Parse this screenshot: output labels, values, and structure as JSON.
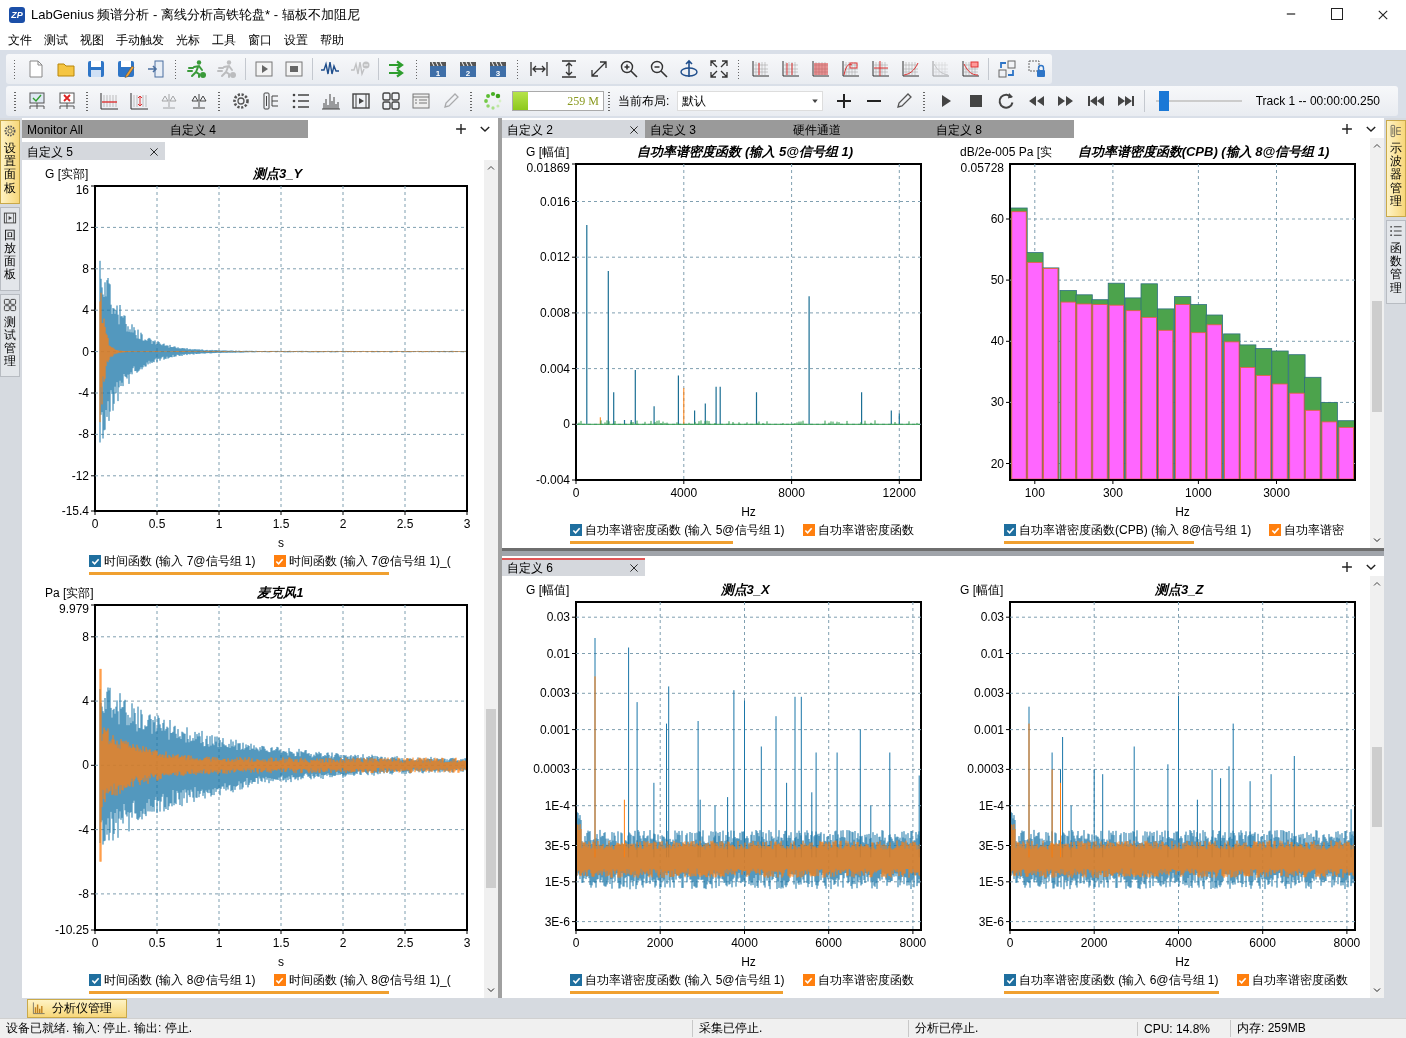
{
  "window": {
    "logo": "ZP",
    "title": "LabGenius 频谱分析 - 离线分析高铁轮盘* - 辐板不加阻尼"
  },
  "menu": [
    "文件",
    "测试",
    "视图",
    "手动触发",
    "光标",
    "工具",
    "窗口",
    "设置",
    "帮助"
  ],
  "toolbar_1": [
    [
      {
        "disabled": false
      },
      {
        "disabled": false
      },
      {
        "disabled": false
      },
      {
        "disabled": false
      },
      {
        "disabled": false
      }
    ],
    [
      {
        "disabled": false
      },
      {
        "disabled": true
      }
    ],
    [
      {
        "disabled": false
      },
      {
        "disabled": false
      }
    ],
    [
      {
        "disabled": false
      },
      {
        "disabled": true
      }
    ],
    [
      {
        "disabled": false
      }
    ],
    [
      {
        "disabled": false,
        "badge": "1"
      },
      {
        "disabled": false,
        "badge": "2"
      },
      {
        "disabled": false,
        "badge": "3"
      }
    ],
    [
      {
        "disabled": false
      },
      {
        "disabled": false
      },
      {
        "disabled": false
      },
      {
        "disabled": false
      },
      {
        "disabled": false
      },
      {
        "disabled": false
      },
      {
        "disabled": false
      }
    ],
    [
      {
        "disabled": false
      },
      {
        "disabled": false
      },
      {
        "disabled": false
      },
      {
        "disabled": false
      },
      {
        "disabled": false
      },
      {
        "disabled": false
      },
      {
        "disabled": true
      },
      {
        "disabled": false
      }
    ],
    [
      {
        "disabled": false
      },
      {
        "disabled": false
      }
    ]
  ],
  "toolbar_2": {
    "buttons": [
      [
        {
          "disabled": false
        },
        {
          "disabled": false
        }
      ],
      [
        {
          "disabled": false
        },
        {
          "disabled": false
        },
        {
          "disabled": true
        },
        {
          "disabled": false
        }
      ],
      [
        {
          "disabled": false
        },
        {
          "disabled": false
        },
        {
          "disabled": false
        },
        {
          "disabled": false
        },
        {
          "disabled": false
        },
        {
          "disabled": false
        },
        {
          "disabled": false
        },
        {
          "disabled": true
        }
      ],
      [
        {
          "disabled": false
        }
      ]
    ],
    "memory": {
      "level": 0.17,
      "reading": "259 M"
    },
    "layout": {
      "label": "当前布局:",
      "value": "默认"
    },
    "layout_buttons": [
      {
        "disabled": false
      },
      {
        "disabled": false
      },
      {
        "disabled": false
      }
    ],
    "transport": [
      {
        "disabled": false
      },
      {
        "disabled": false
      },
      {
        "disabled": false
      },
      {
        "disabled": false
      },
      {
        "disabled": false
      },
      {
        "disabled": false
      },
      {
        "disabled": false
      }
    ],
    "track": {
      "level": 0.03,
      "reading": "Track 1 -- 00:00:00.250"
    }
  },
  "left_side_tabs": [
    {
      "label": "设置面板",
      "selected": true
    },
    {
      "label": "回放面板",
      "selected": false
    },
    {
      "label": "测试管理",
      "selected": false
    }
  ],
  "left_pane": {
    "focused": false,
    "tab_rows": [
      [
        {
          "label": "Monitor All",
          "selected": false
        },
        {
          "label": "自定义 4",
          "selected": false
        }
      ],
      [
        {
          "label": "自定义 5",
          "selected": true
        }
      ]
    ],
    "plots": [
      {
        "kind": "time",
        "title": "测点3_Y",
        "ylabel": "G [实部]",
        "y_ticks": [
          "16",
          "12",
          "8",
          "4",
          "0",
          "-4",
          "-8",
          "-12",
          "-15.4"
        ],
        "x_ticks": [
          "0",
          "0.5",
          "1",
          "1.5",
          "2",
          "2.5",
          "3"
        ],
        "xlabel": "s",
        "legend": [
          {
            "label": "时间函数 (输入 7@信号组 1)",
            "checked": true,
            "color": "#1f6f9f"
          },
          {
            "label": "时间函数 (输入 7@信号组 1)_(",
            "checked": true,
            "color": "#ff7f0e"
          }
        ]
      },
      {
        "kind": "time",
        "title": "麦克风1",
        "ylabel": "Pa [实部]",
        "y_ticks": [
          "9.979",
          "8",
          "4",
          "0",
          "-4",
          "-8",
          "-10.25"
        ],
        "x_ticks": [
          "0",
          "0.5",
          "1",
          "1.5",
          "2",
          "2.5",
          "3"
        ],
        "xlabel": "s",
        "legend": [
          {
            "label": "时间函数 (输入 8@信号组 1)",
            "checked": true,
            "color": "#1f6f9f"
          },
          {
            "label": "时间函数 (输入 8@信号组 1)_(",
            "checked": true,
            "color": "#ff7f0e"
          }
        ]
      }
    ]
  },
  "right_top_pane": {
    "focused": false,
    "tab_rows": [
      [
        {
          "label": "自定义 2",
          "selected": true
        },
        {
          "label": "自定义 3",
          "selected": false
        },
        {
          "label": "硬件通道",
          "selected": false
        },
        {
          "label": "自定义 8",
          "selected": false
        }
      ]
    ],
    "plots": [
      {
        "kind": "spectrum",
        "title": "自功率谱密度函数 (输入 5@信号组 1)",
        "ylabel": "G [幅值]",
        "y_ticks": [
          "0.01869",
          "0.016",
          "0.012",
          "0.008",
          "0.004",
          "0",
          "-0.004"
        ],
        "x_ticks": [
          "0",
          "4000",
          "8000",
          "12000"
        ],
        "xlabel": "Hz",
        "legend": [
          {
            "label": "自功率谱密度函数 (输入 5@信号组 1)",
            "checked": true,
            "color": "#1f6f9f"
          },
          {
            "label": "自功率谱密度函数",
            "checked": true,
            "color": "#ff7f0e"
          }
        ]
      },
      {
        "kind": "cpb",
        "title": "自功率谱密度函数(CPB) (输入 8@信号组 1)",
        "ylabel": "dB/2e-005 Pa [实",
        "top_label": "0.05728",
        "y_ticks": [
          "60",
          "50",
          "40",
          "30",
          "20"
        ],
        "x_ticks": [
          "100",
          "300",
          "1000",
          "3000"
        ],
        "xlabel": "Hz",
        "legend": [
          {
            "label": "自功率谱密度函数(CPB) (输入 8@信号组 1)",
            "checked": true,
            "color": "#1f6f9f"
          },
          {
            "label": "自功率谱密",
            "checked": true,
            "color": "#ff7f0e"
          }
        ]
      }
    ]
  },
  "right_bottom_pane": {
    "focused": true,
    "tab_rows": [
      [
        {
          "label": "自定义 6",
          "selected": true
        }
      ]
    ],
    "plots": [
      {
        "kind": "log_spectrum",
        "title": "测点3_X",
        "ylabel": "G [幅值]",
        "y_ticks": [
          "0.03",
          "0.01",
          "0.003",
          "0.001",
          "0.0003",
          "1E-4",
          "3E-5",
          "1E-5",
          "3E-6"
        ],
        "x_ticks": [
          "0",
          "2000",
          "4000",
          "6000",
          "8000"
        ],
        "xlabel": "Hz",
        "legend": [
          {
            "label": "自功率谱密度函数 (输入 5@信号组 1)",
            "checked": true,
            "color": "#1f6f9f"
          },
          {
            "label": "自功率谱密度函数",
            "checked": true,
            "color": "#ff7f0e"
          }
        ]
      },
      {
        "kind": "log_spectrum",
        "title": "测点3_Z",
        "ylabel": "G [幅值]",
        "y_ticks": [
          "0.03",
          "0.01",
          "0.003",
          "0.001",
          "0.0003",
          "1E-4",
          "3E-5",
          "1E-5",
          "3E-6"
        ],
        "x_ticks": [
          "0",
          "2000",
          "4000",
          "6000",
          "8000"
        ],
        "xlabel": "Hz",
        "legend": [
          {
            "label": "自功率谱密度函数 (输入 6@信号组 1)",
            "checked": true,
            "color": "#1f6f9f"
          },
          {
            "label": "自功率谱密度函数",
            "checked": true,
            "color": "#ff7f0e"
          }
        ]
      }
    ]
  },
  "right_side_tabs": [
    {
      "label": "示波器管理",
      "selected": true
    },
    {
      "label": "函数管理",
      "selected": false
    }
  ],
  "bottom_tabs": [
    {
      "label": "分析仪管理",
      "selected": true
    }
  ],
  "status_bar": [
    "设备已就绪. 输入: 停止. 输出: 停止.",
    "采集已停止.",
    "分析已停止.",
    "CPU: 14.8%",
    "内存: 259MB"
  ]
}
